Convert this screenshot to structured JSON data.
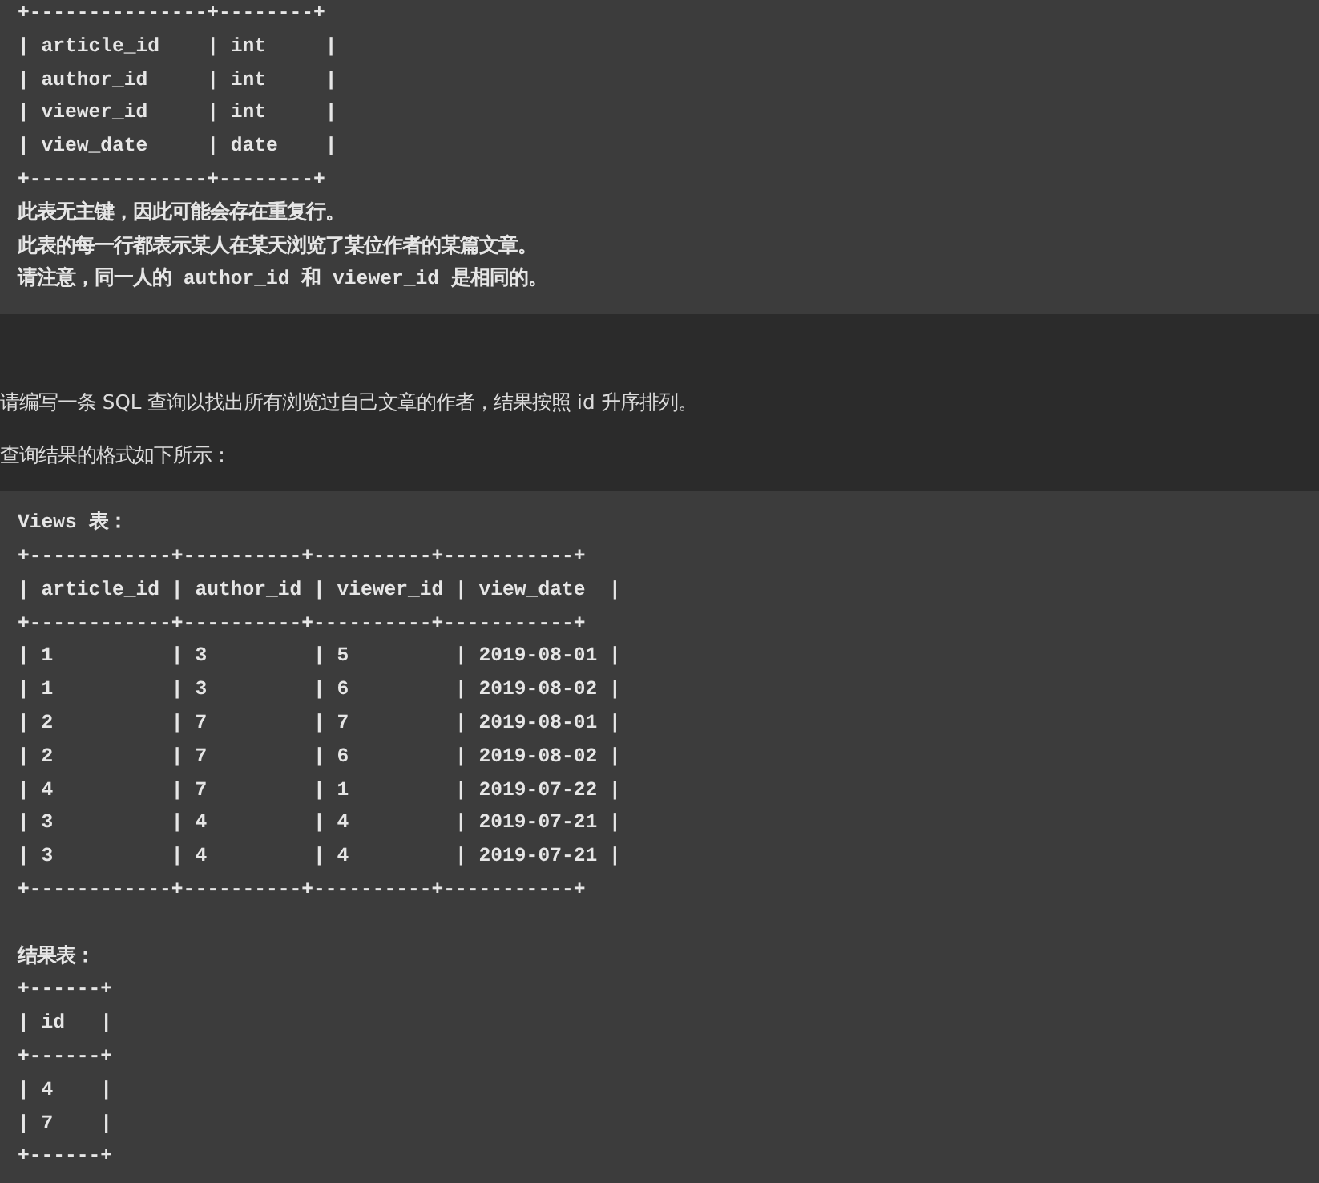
{
  "schema_block": {
    "lines": [
      "+---------------+--------+",
      "| article_id    | int     |",
      "| author_id     | int     |",
      "| viewer_id     | int     |",
      "| view_date     | date    |",
      "+---------------+--------+",
      "此表无主键，因此可能会存在重复行。",
      "此表的每一行都表示某人在某天浏览了某位作者的某篇文章。",
      "请注意，同一人的 author_id 和 viewer_id 是相同的。"
    ]
  },
  "paragraphs": [
    "请编写一条 SQL 查询以找出所有浏览过自己文章的作者，结果按照 id 升序排列。",
    "查询结果的格式如下所示："
  ],
  "example_block": {
    "lines": [
      "Views 表：",
      "+------------+----------+----------+-----------+",
      "| article_id | author_id | viewer_id | view_date  |",
      "+------------+----------+----------+-----------+",
      "| 1          | 3         | 5         | 2019-08-01 |",
      "| 1          | 3         | 6         | 2019-08-02 |",
      "| 2          | 7         | 7         | 2019-08-01 |",
      "| 2          | 7         | 6         | 2019-08-02 |",
      "| 4          | 7         | 1         | 2019-07-22 |",
      "| 3          | 4         | 4         | 2019-07-21 |",
      "| 3          | 4         | 4         | 2019-07-21 |",
      "+------------+----------+----------+-----------+"
    ],
    "result_lines": [
      "结果表：",
      "+------+",
      "| id   |",
      "+------+",
      "| 4    |",
      "| 7    |",
      "+------+"
    ]
  }
}
